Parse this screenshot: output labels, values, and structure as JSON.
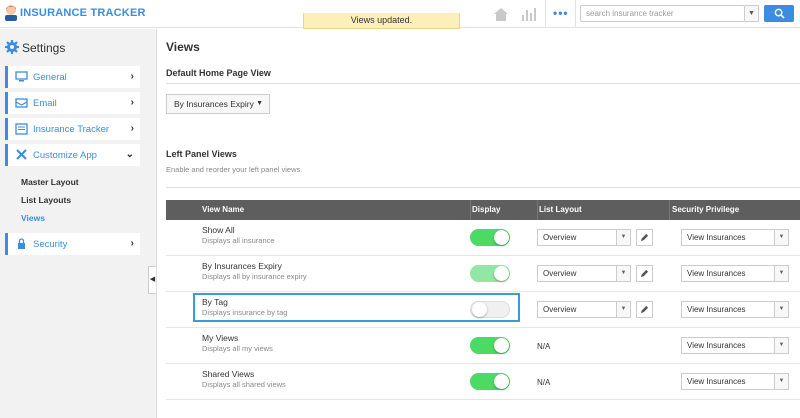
{
  "app": {
    "name": "INSURANCE TRACKER"
  },
  "toast": "Views updated.",
  "search": {
    "placeholder": "search insurance tracker"
  },
  "sidebar": {
    "title": "Settings",
    "items": [
      {
        "label": "General",
        "icon": "monitor-icon"
      },
      {
        "label": "Email",
        "icon": "envelope-icon"
      },
      {
        "label": "Insurance Tracker",
        "icon": "id-card-icon"
      },
      {
        "label": "Customize App",
        "icon": "wrench-icon"
      },
      {
        "label": "Security",
        "icon": "lock-icon"
      }
    ],
    "sub_items": [
      {
        "label": "Master Layout"
      },
      {
        "label": "List Layouts"
      },
      {
        "label": "Views"
      }
    ]
  },
  "main": {
    "title": "Views",
    "default_home": {
      "label": "Default Home Page View",
      "selected": "By Insurances Expiry"
    },
    "left_panel": {
      "label": "Left Panel Views",
      "help": "Enable and reorder your left panel views."
    },
    "table": {
      "headers": {
        "name": "View Name",
        "display": "Display",
        "layout": "List Layout",
        "privilege": "Security Privilege"
      },
      "rows": [
        {
          "name": "Show All",
          "desc": "Displays all insurance",
          "display": true,
          "layout": "Overview",
          "privilege": "View Insurances"
        },
        {
          "name": "By Insurances Expiry",
          "desc": "Displays all by insurance expiry",
          "display": true,
          "layout": "Overview",
          "privilege": "View Insurances"
        },
        {
          "name": "By Tag",
          "desc": "Displays insurance by tag",
          "display": false,
          "layout": "Overview",
          "privilege": "View Insurances"
        },
        {
          "name": "My Views",
          "desc": "Displays all my views",
          "display": true,
          "layout": "N/A",
          "privilege": "View Insurances"
        },
        {
          "name": "Shared Views",
          "desc": "Displays all shared views",
          "display": true,
          "layout": "N/A",
          "privilege": "View Insurances"
        }
      ]
    }
  },
  "colors": {
    "accent": "#3a8de0",
    "toggle_on": "#4cd964",
    "toast_bg": "#fcf0b8",
    "table_header": "#5e5e5e"
  }
}
